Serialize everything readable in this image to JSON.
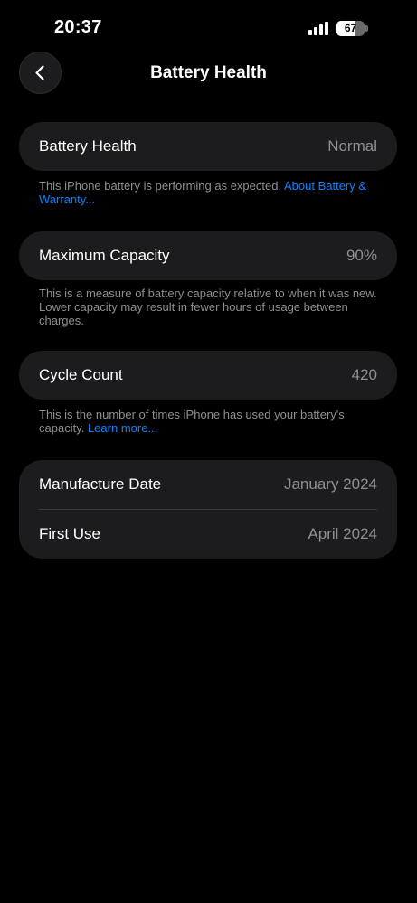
{
  "status_bar": {
    "time": "20:37",
    "battery_level": "67",
    "signal_bars": 4
  },
  "nav": {
    "title": "Battery Health",
    "back_icon": "chevron-left-icon"
  },
  "battery_health": {
    "label": "Battery Health",
    "value": "Normal",
    "footnote_text": "This iPhone battery is performing as expected. ",
    "footnote_link": "About Battery & Warranty..."
  },
  "maximum_capacity": {
    "label": "Maximum Capacity",
    "value": "90%",
    "footnote_text": "This is a measure of battery capacity relative to when it was new. Lower capacity may result in fewer hours of usage between charges."
  },
  "cycle_count": {
    "label": "Cycle Count",
    "value": "420",
    "footnote_text": "This is the number of times iPhone has used your battery's capacity. ",
    "footnote_link": "Learn more..."
  },
  "dates": {
    "manufacture_label": "Manufacture Date",
    "manufacture_value": "January 2024",
    "first_use_label": "First Use",
    "first_use_value": "April 2024"
  },
  "colors": {
    "background": "#000000",
    "card": "#1c1c1e",
    "secondary_text": "#8e8e93",
    "link": "#0a84ff"
  }
}
